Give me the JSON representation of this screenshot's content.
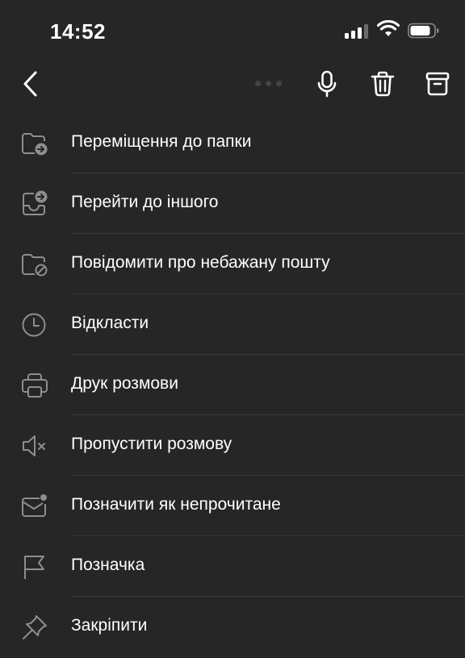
{
  "status_bar": {
    "time": "14:52"
  },
  "colors": {
    "background": "#262626",
    "text": "#ffffff",
    "icon": "#8e8e8e",
    "divider": "#3a3a3a"
  },
  "toolbar": {
    "back_icon": "chevron-left-icon",
    "more_icon": "more-dots-icon",
    "mic_icon": "microphone-icon",
    "delete_icon": "trash-icon",
    "archive_icon": "archive-icon"
  },
  "menu": {
    "items": [
      {
        "label": "Переміщення до папки",
        "icon": "folder-move-icon"
      },
      {
        "label": "Перейти до іншого",
        "icon": "inbox-switch-icon"
      },
      {
        "label": "Повідомити про небажану пошту",
        "icon": "folder-block-icon"
      },
      {
        "label": "Відкласти",
        "icon": "clock-icon"
      },
      {
        "label": "Друк розмови",
        "icon": "printer-icon"
      },
      {
        "label": "Пропустити розмову",
        "icon": "speaker-mute-icon"
      },
      {
        "label": "Позначити як непрочитане",
        "icon": "mail-unread-icon"
      },
      {
        "label": "Позначка",
        "icon": "flag-icon"
      },
      {
        "label": "Закріпити",
        "icon": "pin-icon"
      }
    ]
  }
}
